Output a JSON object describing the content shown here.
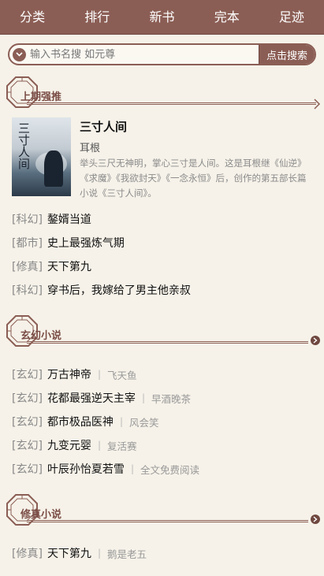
{
  "nav": {
    "items": [
      "分类",
      "排行",
      "新书",
      "完本",
      "足迹"
    ]
  },
  "search": {
    "placeholder": "输入书名搜 如元尊",
    "button": "点击搜索",
    "icon": "chevron-down-icon"
  },
  "sections": {
    "recommend": {
      "title": "上期强推",
      "featured": {
        "cover_text": "三寸人间",
        "title": "三寸人间",
        "author": "耳根",
        "desc": "举头三尺无神明，掌心三寸是人间。这是耳根继《仙逆》《求魔》《我欲封天》《一念永恒》后，创作的第五部长篇小说《三寸人间》。"
      },
      "list": [
        {
          "cat": "[科幻]",
          "name": "鏊婿当道"
        },
        {
          "cat": "[都市]",
          "name": "史上最强炼气期"
        },
        {
          "cat": "[修真]",
          "name": "天下第九"
        },
        {
          "cat": "[科幻]",
          "name": "穿书后，我嫁给了男主他亲叔"
        }
      ]
    },
    "xuanhuan": {
      "title": "玄幻小说",
      "more_icon": "chevron-right-icon",
      "list": [
        {
          "cat": "[玄幻]",
          "name": "万古神帝",
          "sep": "|",
          "author": "飞天鱼"
        },
        {
          "cat": "[玄幻]",
          "name": "花都最强逆天主宰",
          "sep": "|",
          "author": "早酒晚茶"
        },
        {
          "cat": "[玄幻]",
          "name": "都市极品医神",
          "sep": "|",
          "author": "风会笑"
        },
        {
          "cat": "[玄幻]",
          "name": "九变元婴",
          "sep": "|",
          "author": "复活赛"
        },
        {
          "cat": "[玄幻]",
          "name": "叶辰孙怡夏若雪",
          "sep": "|",
          "author": "全文免费阅读"
        }
      ]
    },
    "xiuzhen": {
      "title": "修真小说",
      "more_icon": "chevron-right-icon",
      "list": [
        {
          "cat": "[修真]",
          "name": "天下第九",
          "sep": "|",
          "author": "鹅是老五"
        }
      ]
    }
  },
  "colors": {
    "brand": "#8b5e55",
    "background": "#f6f2e9"
  }
}
